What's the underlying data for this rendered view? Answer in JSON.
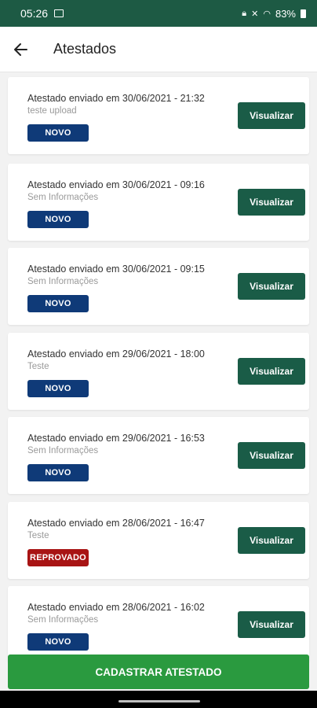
{
  "status_bar": {
    "time": "05:26",
    "battery": "83%"
  },
  "app_bar": {
    "title": "Atestados",
    "back_icon": "arrow-left-icon"
  },
  "items": [
    {
      "title": "Atestado enviado em 30/06/2021 - 21:32",
      "description": "teste upload",
      "status": "NOVO",
      "status_color": "#0f3a78",
      "button": "Visualizar"
    },
    {
      "title": "Atestado enviado em 30/06/2021 - 09:16",
      "description": "Sem Informações",
      "status": "NOVO",
      "status_color": "#0f3a78",
      "button": "Visualizar"
    },
    {
      "title": "Atestado enviado em 30/06/2021 - 09:15",
      "description": "Sem Informações",
      "status": "NOVO",
      "status_color": "#0f3a78",
      "button": "Visualizar"
    },
    {
      "title": "Atestado enviado em 29/06/2021 - 18:00",
      "description": "Teste",
      "status": "NOVO",
      "status_color": "#0f3a78",
      "button": "Visualizar"
    },
    {
      "title": "Atestado enviado em 29/06/2021 - 16:53",
      "description": "Sem Informações",
      "status": "NOVO",
      "status_color": "#0f3a78",
      "button": "Visualizar"
    },
    {
      "title": "Atestado enviado em 28/06/2021 - 16:47",
      "description": "Teste",
      "status": "REPROVADO",
      "status_color": "#a81414",
      "button": "Visualizar"
    },
    {
      "title": "Atestado enviado em 28/06/2021 - 16:02",
      "description": "Sem Informações",
      "status": "NOVO",
      "status_color": "#0f3a78",
      "button": "Visualizar"
    }
  ],
  "footer": {
    "button_label": "CADASTRAR ATESTADO"
  },
  "colors": {
    "status_bar": "#1d5a44",
    "view_button": "#1a5c47",
    "primary_button": "#2a9a3f"
  }
}
